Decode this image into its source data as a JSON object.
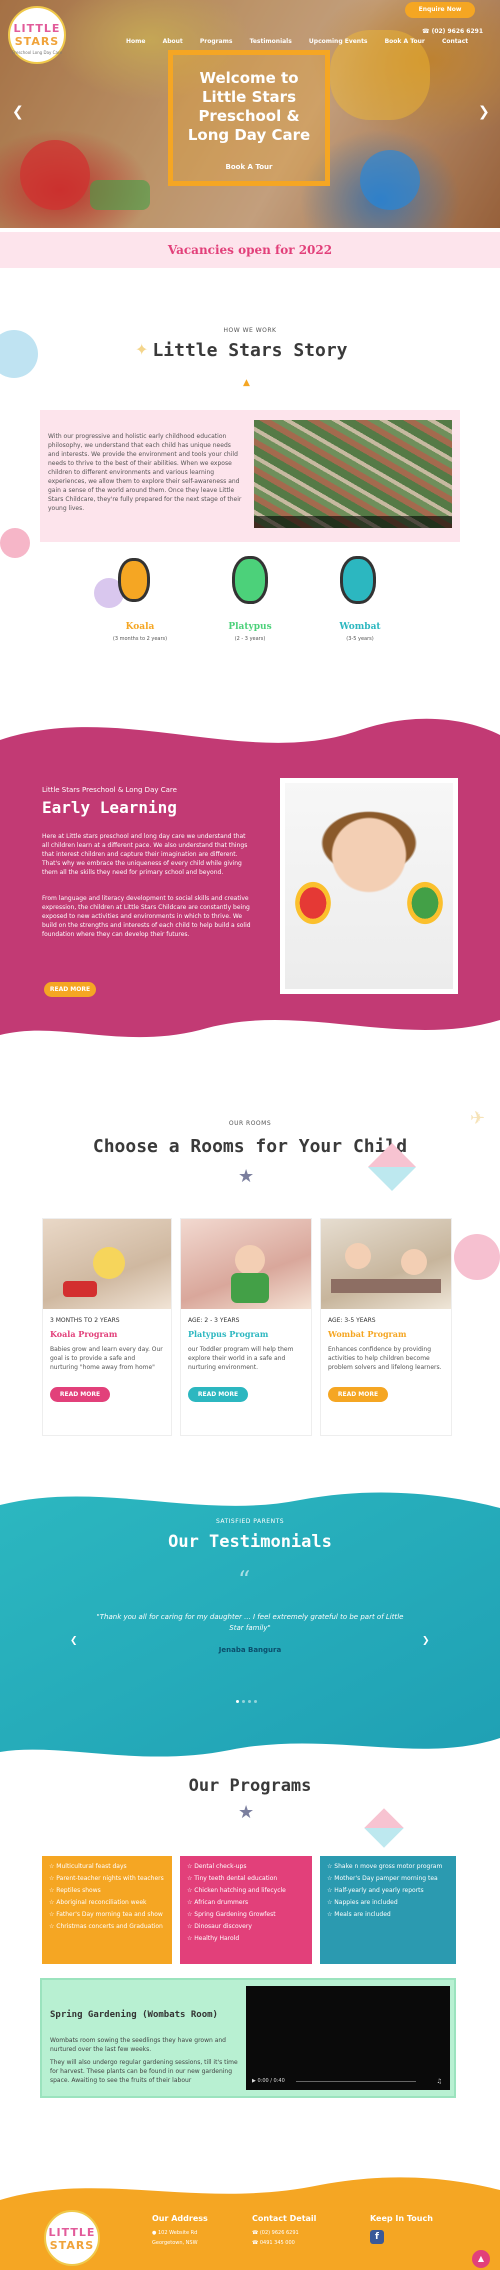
{
  "colors": {
    "pink": "#e2407a",
    "orange": "#f5a623",
    "teal": "#2cb7c0",
    "green": "#7ed957",
    "magenta": "#c23a74"
  },
  "header": {
    "logo": {
      "line1": "LITTLE",
      "line2": "STARS",
      "line3": "Preschool Long Day Care"
    },
    "nav": [
      "Home",
      "About",
      "Programs",
      "Testimonials",
      "Upcoming Events",
      "Book A Tour",
      "Contact"
    ],
    "phone": "(02) 9626 6291",
    "enquire_label": "Enquire Now"
  },
  "hero": {
    "title": "Welcome to Little Stars Preschool & Long Day Care",
    "button_label": "Book A Tour",
    "prev_icon": "chevron-left-icon",
    "next_icon": "chevron-right-icon"
  },
  "vacancy_text": "Vacancies open for 2022",
  "story": {
    "kicker": "HOW WE WORK",
    "title": "Little Stars Story",
    "body": "With our progressive and holistic early childhood education philosophy, we understand that each child has unique needs and interests. We provide the environment and tools your child needs to thrive to the best of their abilities. When we expose children to different environments and various learning experiences, we allow them to explore their self-awareness and gain a sense of the world around them. Once they leave Little Stars Childcare, they're fully prepared for the next stage of their young lives."
  },
  "age_groups": [
    {
      "name": "Koala",
      "range": "(3 months to 2 years)",
      "color": "#f5a623"
    },
    {
      "name": "Platypus",
      "range": "(2 - 3 years)",
      "color": "#4cd17a"
    },
    {
      "name": "Wombat",
      "range": "(3-5 years)",
      "color": "#2cb7c0"
    }
  ],
  "early": {
    "kicker": "Little Stars Preschool & Long Day Care",
    "title": "Early Learning",
    "p1": "Here at Little stars preschool and long day care we understand that all children learn at a different pace. We also understand that things that interest children and capture their imagination are different. That's why we embrace the uniqueness of every child while giving them all the skills they need for primary school and beyond.",
    "p2": "From language and literacy development to social skills and creative expression, the children at Little Stars Childcare are constantly being exposed to new activities and environments in which to thrive. We build on the strengths and interests of each child to help build a solid foundation where they can develop their futures.",
    "button_label": "READ MORE"
  },
  "rooms": {
    "kicker": "OUR ROOMS",
    "title": "Choose a Rooms for Your Child",
    "items": [
      {
        "age": "3 MONTHS TO 2 YEARS",
        "name": "Koala Program",
        "desc": "Babies grow and learn every day. Our goal is to provide a safe and nurturing \"home away from home\"",
        "button": "READ MORE",
        "color": "#e2407a"
      },
      {
        "age": "AGE: 2 - 3 YEARS",
        "name": "Platypus Program",
        "desc": "our Toddler program will help them explore their world in a safe and nurturing environment.",
        "button": "READ MORE",
        "color": "#2cb7c0"
      },
      {
        "age": "AGE: 3-5 YEARS",
        "name": "Wombat Program",
        "desc": "Enhances confidence by providing activities to help children become problem solvers and lifelong learners.",
        "button": "READ MORE",
        "color": "#f5a623"
      }
    ]
  },
  "testimonials": {
    "kicker": "SATISFIED PARENTS",
    "title": "Our Testimonials",
    "quote": "\"Thank you all for caring for my daughter ... I feel extremely grateful to be part of Little Star family\"",
    "author": "Jenaba Bangura"
  },
  "programs": {
    "title": "Our Programs",
    "lists": [
      {
        "color": "#f5a623",
        "items": [
          "Multicultural feast days",
          "Parent-teacher nights with teachers",
          "Reptiles shows",
          "Aboriginal reconciliation week",
          "Father's Day morning tea and show",
          "Christmas concerts and Graduation"
        ]
      },
      {
        "color": "#e2407a",
        "items": [
          "Dental check-ups",
          "Tiny teeth dental education",
          "Chicken hatching and lifecycle",
          "African drummers",
          "Spring Gardening Growfest",
          "Dinosaur discovery",
          "Healthy Harold"
        ]
      },
      {
        "color": "#2b9ab0",
        "items": [
          "Shake n move gross motor program",
          "Mother's Day pamper morning tea",
          "Half-yearly and yearly reports",
          "Nappies are included",
          "Meals are included"
        ]
      }
    ]
  },
  "spring": {
    "title": "Spring Gardening (Wombats Room)",
    "p1": "Wombats room sowing the seedlings they have grown and nurtured over the last few weeks.",
    "p2": "They will also undergo regular gardening sessions, till it's time for harvest. These plants can be found in our new gardening space. Awaiting to see the fruits of their labour",
    "video_time": "0:00 / 0:40"
  },
  "footer": {
    "address_title": "Our Address",
    "address_line": "102 Website Rd",
    "address_line2": "Georgetown, NSW",
    "contact_title": "Contact Detail",
    "phone": "(02) 9626 6291",
    "phone2": "0491 345 000",
    "touch_title": "Keep In Touch",
    "facebook_icon": "facebook-icon"
  }
}
